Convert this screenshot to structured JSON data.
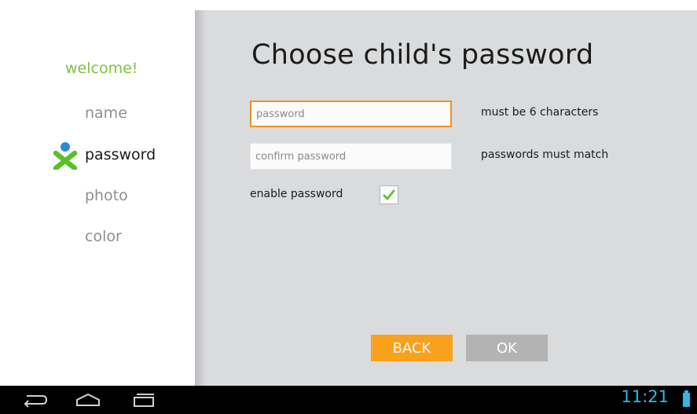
{
  "sidebar": {
    "welcome": "welcome!",
    "steps": [
      {
        "label": "name"
      },
      {
        "label": "password"
      },
      {
        "label": "photo"
      },
      {
        "label": "color"
      }
    ]
  },
  "main": {
    "title": "Choose child's password",
    "password_placeholder": "password",
    "password_hint": "must be 6 characters",
    "confirm_placeholder": "confirm password",
    "confirm_hint": "passwords must match",
    "enable_label": "enable password",
    "enable_checked": true,
    "back_label": "BACK",
    "ok_label": "OK"
  },
  "statusbar": {
    "time": "11:21"
  },
  "colors": {
    "accent_orange": "#f9a11b",
    "welcome_green": "#7fc241",
    "clock_blue": "#33b5e5"
  },
  "icons": [
    "xo-logo-icon",
    "back-nav-icon",
    "home-nav-icon",
    "recents-nav-icon",
    "checkmark-icon",
    "battery-icon"
  ]
}
